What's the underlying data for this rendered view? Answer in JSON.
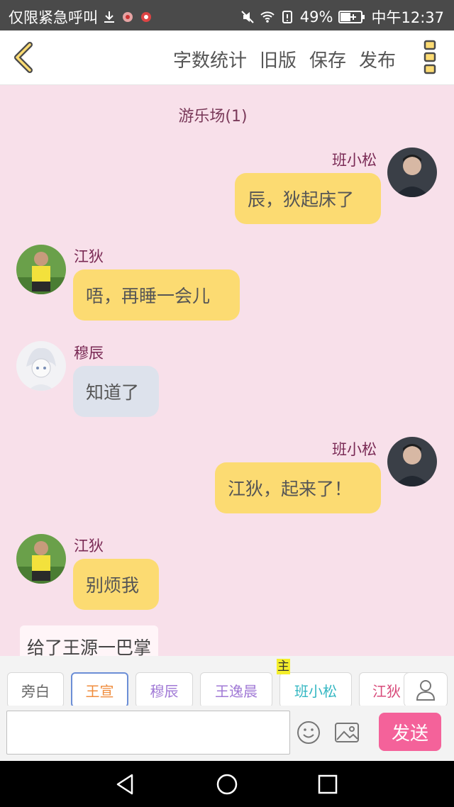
{
  "status_bar": {
    "left_text": "仅限紧急呼叫",
    "battery": "49%",
    "time": "中午12:37"
  },
  "toolbar": {
    "actions": [
      "字数统计",
      "旧版",
      "保存",
      "发布"
    ]
  },
  "chat": {
    "title": "游乐场(1)",
    "messages": [
      {
        "name": "班小松",
        "text": "辰，狄起床了"
      },
      {
        "name": "江狄",
        "text": "唔，再睡一会儿"
      },
      {
        "name": "穆辰",
        "text": "知道了"
      },
      {
        "name": "班小松",
        "text": "江狄，起来了！"
      },
      {
        "name": "江狄",
        "text": "别烦我"
      }
    ],
    "narration": "给了王源一巴掌"
  },
  "roles": {
    "items": [
      {
        "label": "旁白",
        "color": "#666666"
      },
      {
        "label": "王宣",
        "color": "#f08c3c"
      },
      {
        "label": "穆辰",
        "color": "#a17ad6"
      },
      {
        "label": "王逸晨",
        "color": "#a17ad6"
      },
      {
        "label": "班小松",
        "color": "#34b7c2"
      },
      {
        "label": "江狄",
        "color": "#d84a7a"
      }
    ],
    "host_tag": "主"
  },
  "input": {
    "value": "",
    "placeholder": ""
  },
  "send_label": "发送",
  "colors": {
    "chat_bg": "#f8e0ea",
    "bubble_yellow": "#fcdb72",
    "bubble_gray": "#dde2ec",
    "send": "#f4629a"
  }
}
